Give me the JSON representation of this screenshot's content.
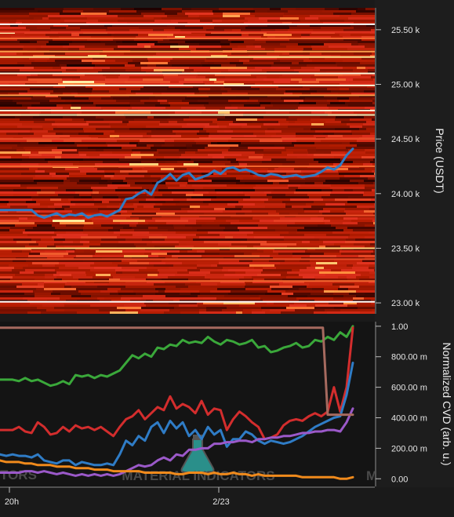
{
  "chart_data": [
    {
      "type": "heatmap",
      "title": "",
      "ylabel": "Price (USDT)",
      "ylim": [
        22900,
        25700
      ],
      "y_ticks": [
        23000,
        23500,
        24000,
        24500,
        25000,
        25500
      ],
      "y_tick_labels": [
        "23.00 k",
        "23.50 k",
        "24.00 k",
        "24.50 k",
        "25.00 k",
        "25.50 k"
      ],
      "grid": false,
      "colorscale": [
        "#1a0000",
        "#5a0a00",
        "#b31b00",
        "#e0301e",
        "#ff8c3c",
        "#ffe98c",
        "#ffffff"
      ],
      "heatmap_lines": [
        {
          "price": 25550,
          "intensity": 1.0
        },
        {
          "price": 25480,
          "intensity": 0.5
        },
        {
          "price": 25420,
          "intensity": 0.6
        },
        {
          "price": 25300,
          "intensity": 0.7
        },
        {
          "price": 25250,
          "intensity": 0.85
        },
        {
          "price": 25100,
          "intensity": 0.95
        },
        {
          "price": 24990,
          "intensity": 0.95
        },
        {
          "price": 24900,
          "intensity": 0.7
        },
        {
          "price": 24760,
          "intensity": 0.95
        },
        {
          "price": 24720,
          "intensity": 0.9
        },
        {
          "price": 24500,
          "intensity": 0.55
        },
        {
          "price": 24250,
          "intensity": 0.6
        },
        {
          "price": 23800,
          "intensity": 0.55
        },
        {
          "price": 23500,
          "intensity": 0.8
        },
        {
          "price": 23400,
          "intensity": 0.55
        },
        {
          "price": 23200,
          "intensity": 0.6
        },
        {
          "price": 23010,
          "intensity": 1.0
        }
      ],
      "series": [
        {
          "color": "#2f7cc6",
          "x": [
            0,
            8,
            16,
            24,
            32,
            40,
            48,
            56,
            64,
            72,
            80,
            88,
            96,
            104,
            112,
            120,
            128,
            136,
            144,
            152,
            160,
            168,
            176,
            184,
            192,
            200,
            208,
            216,
            224,
            232,
            240,
            248,
            256,
            264,
            272,
            280,
            288,
            296,
            304,
            312,
            320,
            328,
            336,
            344,
            352,
            360,
            368,
            376,
            384,
            392,
            400,
            408,
            416,
            424,
            432,
            440,
            448
          ],
          "y": [
            23850,
            23850,
            23850,
            23850,
            23850,
            23850,
            23800,
            23780,
            23800,
            23820,
            23790,
            23810,
            23800,
            23820,
            23780,
            23800,
            23810,
            23790,
            23820,
            23850,
            23950,
            23960,
            24000,
            24030,
            23990,
            24100,
            24130,
            24180,
            24120,
            24170,
            24190,
            24130,
            24150,
            24170,
            24210,
            24180,
            24230,
            24240,
            24210,
            24220,
            24200,
            24170,
            24160,
            24180,
            24170,
            24150,
            24160,
            24170,
            24150,
            24160,
            24170,
            24200,
            24240,
            24220,
            24260,
            24350,
            24410
          ]
        }
      ]
    },
    {
      "type": "line",
      "title": "",
      "ylabel": "Normalized CVD (arb. u.)",
      "xlabel": "",
      "ylim": [
        -0.05,
        1.03
      ],
      "y_ticks": [
        0,
        0.2,
        0.4,
        0.6,
        0.8,
        1.0
      ],
      "y_tick_labels": [
        "0.00",
        "200.00 m",
        "400.00 m",
        "600.00 m",
        "800.00 m",
        "1.00"
      ],
      "x_ticks": [
        12,
        279
      ],
      "x_tick_labels": [
        "20h",
        "2/23"
      ],
      "grid": false,
      "series": [
        {
          "color": "#3aa83a",
          "x": [
            0,
            8,
            16,
            24,
            32,
            40,
            48,
            56,
            64,
            72,
            80,
            88,
            96,
            104,
            112,
            120,
            128,
            136,
            144,
            152,
            160,
            168,
            176,
            184,
            192,
            200,
            208,
            216,
            224,
            232,
            240,
            248,
            256,
            264,
            272,
            280,
            288,
            296,
            304,
            312,
            320,
            328,
            336,
            344,
            352,
            360,
            368,
            376,
            384,
            392,
            400,
            408,
            416,
            424,
            432,
            440,
            448
          ],
          "y": [
            0.65,
            0.65,
            0.65,
            0.64,
            0.66,
            0.64,
            0.65,
            0.63,
            0.61,
            0.62,
            0.64,
            0.62,
            0.68,
            0.67,
            0.68,
            0.66,
            0.68,
            0.67,
            0.69,
            0.71,
            0.76,
            0.81,
            0.79,
            0.82,
            0.8,
            0.86,
            0.85,
            0.88,
            0.87,
            0.91,
            0.89,
            0.9,
            0.89,
            0.93,
            0.9,
            0.88,
            0.91,
            0.9,
            0.88,
            0.89,
            0.91,
            0.86,
            0.87,
            0.83,
            0.84,
            0.86,
            0.87,
            0.89,
            0.86,
            0.87,
            0.91,
            0.9,
            0.93,
            0.91,
            0.96,
            0.93,
            1.0
          ]
        },
        {
          "color": "#d32d2d",
          "x": [
            0,
            8,
            16,
            24,
            32,
            40,
            48,
            56,
            64,
            72,
            80,
            88,
            96,
            104,
            112,
            120,
            128,
            136,
            144,
            152,
            160,
            168,
            176,
            184,
            192,
            200,
            208,
            216,
            224,
            232,
            240,
            248,
            256,
            264,
            272,
            280,
            288,
            296,
            304,
            312,
            320,
            328,
            336,
            344,
            352,
            360,
            368,
            376,
            384,
            392,
            400,
            408,
            416,
            424,
            432,
            440,
            448
          ],
          "y": [
            0.32,
            0.32,
            0.32,
            0.34,
            0.31,
            0.3,
            0.37,
            0.34,
            0.29,
            0.3,
            0.34,
            0.31,
            0.35,
            0.33,
            0.34,
            0.32,
            0.34,
            0.31,
            0.28,
            0.34,
            0.39,
            0.41,
            0.45,
            0.39,
            0.43,
            0.47,
            0.45,
            0.54,
            0.46,
            0.49,
            0.47,
            0.43,
            0.51,
            0.42,
            0.46,
            0.45,
            0.32,
            0.39,
            0.44,
            0.41,
            0.37,
            0.34,
            0.26,
            0.27,
            0.29,
            0.35,
            0.38,
            0.39,
            0.38,
            0.41,
            0.43,
            0.41,
            0.44,
            0.6,
            0.44,
            0.6,
            0.99
          ]
        },
        {
          "color": "#2f7cc6",
          "x": [
            0,
            8,
            16,
            24,
            32,
            40,
            48,
            56,
            64,
            72,
            80,
            88,
            96,
            104,
            112,
            120,
            128,
            136,
            144,
            152,
            160,
            168,
            176,
            184,
            192,
            200,
            208,
            216,
            224,
            232,
            240,
            248,
            256,
            264,
            272,
            280,
            288,
            296,
            304,
            312,
            320,
            328,
            336,
            344,
            352,
            360,
            368,
            376,
            384,
            392,
            400,
            408,
            416,
            424,
            432,
            440,
            448
          ],
          "y": [
            0.16,
            0.15,
            0.16,
            0.15,
            0.15,
            0.14,
            0.16,
            0.12,
            0.11,
            0.1,
            0.12,
            0.12,
            0.09,
            0.11,
            0.1,
            0.09,
            0.09,
            0.1,
            0.09,
            0.16,
            0.25,
            0.22,
            0.28,
            0.25,
            0.34,
            0.37,
            0.3,
            0.38,
            0.33,
            0.37,
            0.28,
            0.32,
            0.26,
            0.34,
            0.29,
            0.32,
            0.21,
            0.26,
            0.26,
            0.31,
            0.29,
            0.25,
            0.23,
            0.25,
            0.24,
            0.23,
            0.24,
            0.26,
            0.28,
            0.31,
            0.34,
            0.36,
            0.38,
            0.4,
            0.41,
            0.55,
            0.76
          ]
        },
        {
          "color": "#9b59c9",
          "x": [
            0,
            8,
            16,
            24,
            32,
            40,
            48,
            56,
            64,
            72,
            80,
            88,
            96,
            104,
            112,
            120,
            128,
            136,
            144,
            152,
            160,
            168,
            176,
            184,
            192,
            200,
            208,
            216,
            224,
            232,
            240,
            248,
            256,
            264,
            272,
            280,
            288,
            296,
            304,
            312,
            320,
            328,
            336,
            344,
            352,
            360,
            368,
            376,
            384,
            392,
            400,
            408,
            416,
            424,
            432,
            440,
            448
          ],
          "y": [
            0.04,
            0.04,
            0.04,
            0.04,
            0.05,
            0.05,
            0.04,
            0.05,
            0.04,
            0.03,
            0.04,
            0.03,
            0.02,
            0.03,
            0.02,
            0.03,
            0.02,
            0.03,
            0.02,
            0.03,
            0.05,
            0.07,
            0.09,
            0.08,
            0.09,
            0.12,
            0.14,
            0.12,
            0.16,
            0.15,
            0.19,
            0.19,
            0.2,
            0.2,
            0.23,
            0.23,
            0.24,
            0.24,
            0.25,
            0.25,
            0.24,
            0.26,
            0.26,
            0.27,
            0.27,
            0.28,
            0.28,
            0.29,
            0.3,
            0.3,
            0.31,
            0.31,
            0.32,
            0.32,
            0.31,
            0.37,
            0.46
          ]
        },
        {
          "color": "#f08a1c",
          "x": [
            0,
            8,
            16,
            24,
            32,
            40,
            48,
            56,
            64,
            72,
            80,
            88,
            96,
            104,
            112,
            120,
            128,
            136,
            144,
            152,
            160,
            168,
            176,
            184,
            192,
            200,
            208,
            216,
            224,
            232,
            240,
            248,
            256,
            264,
            272,
            280,
            288,
            296,
            304,
            312,
            320,
            328,
            336,
            344,
            352,
            360,
            368,
            376,
            384,
            392,
            400,
            408,
            416,
            424,
            432,
            440,
            448
          ],
          "y": [
            0.12,
            0.11,
            0.11,
            0.11,
            0.1,
            0.1,
            0.09,
            0.09,
            0.09,
            0.08,
            0.08,
            0.08,
            0.07,
            0.07,
            0.07,
            0.06,
            0.06,
            0.06,
            0.05,
            0.05,
            0.05,
            0.05,
            0.05,
            0.04,
            0.04,
            0.04,
            0.04,
            0.04,
            0.03,
            0.03,
            0.04,
            0.04,
            0.04,
            0.03,
            0.04,
            0.03,
            0.03,
            0.04,
            0.03,
            0.03,
            0.02,
            0.03,
            0.02,
            0.02,
            0.02,
            0.02,
            0.02,
            0.02,
            0.01,
            0.01,
            0.01,
            0.01,
            0.01,
            0.01,
            0.0,
            0.0,
            0.01
          ]
        },
        {
          "color": "#a66a5f",
          "x": [
            0,
            20,
            40,
            80,
            120,
            160,
            200,
            240,
            280,
            320,
            360,
            400,
            410,
            416,
            424,
            432,
            440,
            448
          ],
          "y": [
            0.99,
            0.99,
            0.99,
            0.99,
            0.99,
            0.99,
            0.99,
            0.99,
            0.99,
            0.99,
            0.99,
            0.99,
            0.99,
            0.42,
            0.42,
            0.42,
            0.42,
            0.42
          ]
        }
      ]
    }
  ],
  "watermark": {
    "text": "MATERIAL INDICATORS",
    "left_fragment": "TORS",
    "right_fragment": "M"
  },
  "colors": {
    "background": "#1a1a1a",
    "axis_panel": "#2a2a2a",
    "tick_text": "#e6e6e6"
  }
}
